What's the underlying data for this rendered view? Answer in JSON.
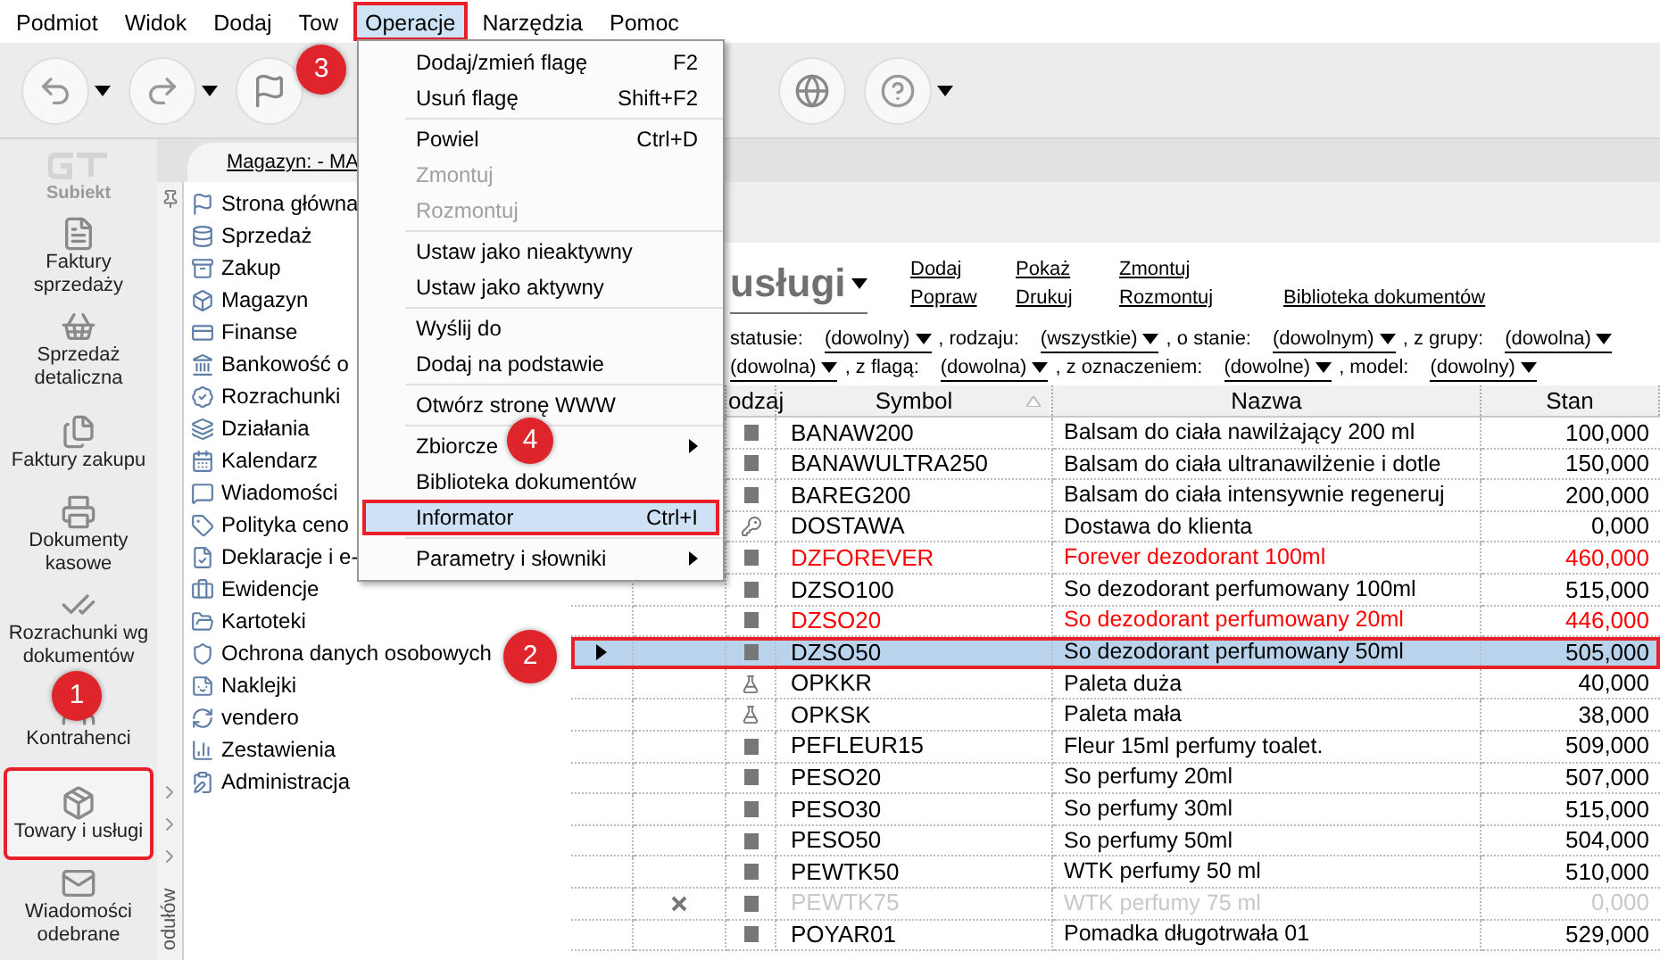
{
  "menu_bar": [
    {
      "label": "Podmiot",
      "selected": false
    },
    {
      "label": "Widok",
      "selected": false
    },
    {
      "label": "Dodaj",
      "selected": false
    },
    {
      "label": "Tow",
      "selected": false
    },
    {
      "label": "Operacje",
      "selected": true
    },
    {
      "label": "Narzędzia",
      "selected": false
    },
    {
      "label": "Pomoc",
      "selected": false
    }
  ],
  "app_logo": {
    "name": "Subiekt"
  },
  "sidebar": {
    "items": [
      {
        "label": "Faktury sprzedaży",
        "selected": false
      },
      {
        "label": "Sprzedaż detaliczna",
        "selected": false
      },
      {
        "label": "Faktury zakupu",
        "selected": false
      },
      {
        "label": "Dokumenty kasowe",
        "selected": false
      },
      {
        "label": "Rozrachunki wg dokumentów",
        "selected": false
      },
      {
        "label": "Kontrahenci",
        "selected": false
      },
      {
        "label": "Towary i usługi",
        "selected": true
      },
      {
        "label": "Wiadomości odebrane",
        "selected": false
      }
    ]
  },
  "modules_panel": {
    "title": "odułów",
    "items": [
      "Strona główna",
      "Sprzedaż",
      "Zakup",
      "Magazyn",
      "Finanse",
      "Bankowość o",
      "Rozrachunki",
      "Działania",
      "Kalendarz",
      "Wiadomości",
      "Polityka ceno",
      "Deklaracje i e-",
      "Ewidencje",
      "Kartoteki",
      "Ochrona danych osobowych",
      "Naklejki",
      "vendero",
      "Zestawienia",
      "Administracja"
    ]
  },
  "tab": {
    "label": "Magazyn: - MA"
  },
  "page": {
    "title": "usługi",
    "action_columns": [
      {
        "links": [
          "Dodaj",
          "Popraw"
        ]
      },
      {
        "links": [
          "Pokaż",
          "Drukuj"
        ]
      },
      {
        "links": [
          "Zmontuj",
          "Rozmontuj"
        ]
      },
      {
        "links": [
          "Biblioteka dokumentów"
        ]
      }
    ]
  },
  "filters": {
    "lines": [
      {
        "parts": [
          {
            "label": "statusie:",
            "value": "(dowolny)"
          },
          {
            "label": ", rodzaju:",
            "value": "(wszystkie)"
          },
          {
            "label": ", o stanie:",
            "value": "(dowolnym)"
          },
          {
            "label": ", z grupy:",
            "value": "(dowolna)"
          }
        ]
      },
      {
        "parts": [
          {
            "value": "(dowolna)"
          },
          {
            "label": ", z flagą:",
            "value": "(dowolna)"
          },
          {
            "label": ", z oznaczeniem:",
            "value": "(dowolne)"
          },
          {
            "label": ", model:",
            "value": "(dowolny)"
          }
        ]
      }
    ]
  },
  "table": {
    "columns": [
      {
        "label": "odzaj",
        "sorted": false
      },
      {
        "label": "Symbol",
        "sorted": true
      },
      {
        "label": "Nazwa",
        "sorted": false
      },
      {
        "label": "Stan",
        "sorted": false
      }
    ],
    "rows": [
      {
        "kind": "goods",
        "symbol": "BANAW200",
        "name": "Balsam do ciała nawilżający 200 ml",
        "stock": "100,000",
        "color": "#000000",
        "inactive": false,
        "selected": false
      },
      {
        "kind": "goods",
        "symbol": "BANAWULTRA250",
        "name": "Balsam do ciała ultranawilżenie i dotle",
        "stock": "150,000",
        "color": "#000000",
        "inactive": false,
        "selected": false
      },
      {
        "kind": "goods",
        "symbol": "BAREG200",
        "name": "Balsam do ciała intensywnie regeneruj",
        "stock": "200,000",
        "color": "#000000",
        "inactive": false,
        "selected": false
      },
      {
        "kind": "service",
        "symbol": "DOSTAWA",
        "name": "Dostawa do klienta",
        "stock": "0,000",
        "color": "#000000",
        "inactive": false,
        "selected": false
      },
      {
        "kind": "goods",
        "symbol": "DZFOREVER",
        "name": "Forever dezodorant 100ml",
        "stock": "460,000",
        "color": "#ff0000",
        "inactive": false,
        "selected": false
      },
      {
        "kind": "goods",
        "symbol": "DZSO100",
        "name": "So dezodorant perfumowany 100ml",
        "stock": "515,000",
        "color": "#000000",
        "inactive": false,
        "selected": false
      },
      {
        "kind": "goods",
        "symbol": "DZSO20",
        "name": "So dezodorant perfumowany 20ml",
        "stock": "446,000",
        "color": "#ff0000",
        "inactive": false,
        "selected": false
      },
      {
        "kind": "goods",
        "symbol": "DZSO50",
        "name": "So dezodorant perfumowany 50ml",
        "stock": "505,000",
        "color": "#000000",
        "inactive": false,
        "selected": true
      },
      {
        "kind": "packaging",
        "symbol": "OPKKR",
        "name": "Paleta duża",
        "stock": "40,000",
        "color": "#000000",
        "inactive": false,
        "selected": false
      },
      {
        "kind": "packaging",
        "symbol": "OPKSK",
        "name": "Paleta mała",
        "stock": "38,000",
        "color": "#000000",
        "inactive": false,
        "selected": false
      },
      {
        "kind": "goods",
        "symbol": "PEFLEUR15",
        "name": "Fleur 15ml perfumy toalet.",
        "stock": "509,000",
        "color": "#000000",
        "inactive": false,
        "selected": false
      },
      {
        "kind": "goods",
        "symbol": "PESO20",
        "name": "So perfumy 20ml",
        "stock": "507,000",
        "color": "#000000",
        "inactive": false,
        "selected": false
      },
      {
        "kind": "goods",
        "symbol": "PESO30",
        "name": "So perfumy 30ml",
        "stock": "515,000",
        "color": "#000000",
        "inactive": false,
        "selected": false
      },
      {
        "kind": "goods",
        "symbol": "PESO50",
        "name": "So perfumy 50ml",
        "stock": "504,000",
        "color": "#000000",
        "inactive": false,
        "selected": false
      },
      {
        "kind": "goods",
        "symbol": "PEWTK50",
        "name": "WTK perfumy 50 ml",
        "stock": "510,000",
        "color": "#000000",
        "inactive": false,
        "selected": false
      },
      {
        "kind": "goods",
        "symbol": "PEWTK75",
        "name": "WTK perfumy 75 ml",
        "stock": "0,000",
        "color": "#c8c8c8",
        "inactive": true,
        "selected": false
      },
      {
        "kind": "goods",
        "symbol": "POYAR01",
        "name": "Pomadka długotrwała 01",
        "stock": "529,000",
        "color": "#000000",
        "inactive": false,
        "selected": false
      }
    ]
  },
  "context_menu": {
    "groups": [
      {
        "items": [
          {
            "label": "Dodaj/zmień flagę",
            "shortcut": "F2",
            "disabled": false,
            "submenu": false,
            "selected": false
          },
          {
            "label": "Usuń flagę",
            "shortcut": "Shift+F2",
            "disabled": false,
            "submenu": false,
            "selected": false
          }
        ]
      },
      {
        "items": [
          {
            "label": "Powiel",
            "shortcut": "Ctrl+D",
            "disabled": false,
            "submenu": false,
            "selected": false
          },
          {
            "label": "Zmontuj",
            "disabled": true,
            "submenu": false,
            "selected": false
          },
          {
            "label": "Rozmontuj",
            "disabled": true,
            "submenu": false,
            "selected": false
          }
        ]
      },
      {
        "items": [
          {
            "label": "Ustaw jako nieaktywny",
            "disabled": false,
            "submenu": false,
            "selected": false
          },
          {
            "label": "Ustaw jako aktywny",
            "disabled": false,
            "submenu": false,
            "selected": false
          }
        ]
      },
      {
        "items": [
          {
            "label": "Wyślij do",
            "disabled": false,
            "submenu": false,
            "selected": false
          },
          {
            "label": "Dodaj na podstawie",
            "disabled": false,
            "submenu": false,
            "selected": false
          }
        ]
      },
      {
        "items": [
          {
            "label": "Otwórz stronę WWW",
            "disabled": false,
            "submenu": false,
            "selected": false
          }
        ]
      },
      {
        "items": [
          {
            "label": "Zbiorcze",
            "disabled": false,
            "submenu": true,
            "selected": false
          },
          {
            "label": "Biblioteka dokumentów",
            "disabled": false,
            "submenu": false,
            "selected": false
          },
          {
            "label": "Informator",
            "shortcut": "Ctrl+I",
            "disabled": false,
            "submenu": false,
            "selected": true
          }
        ]
      },
      {
        "items": [
          {
            "label": "Parametry i słowniki",
            "disabled": false,
            "submenu": true,
            "selected": false
          }
        ]
      }
    ]
  },
  "callouts": [
    {
      "label": "1"
    },
    {
      "label": "2"
    },
    {
      "label": "3"
    },
    {
      "label": "4"
    }
  ]
}
